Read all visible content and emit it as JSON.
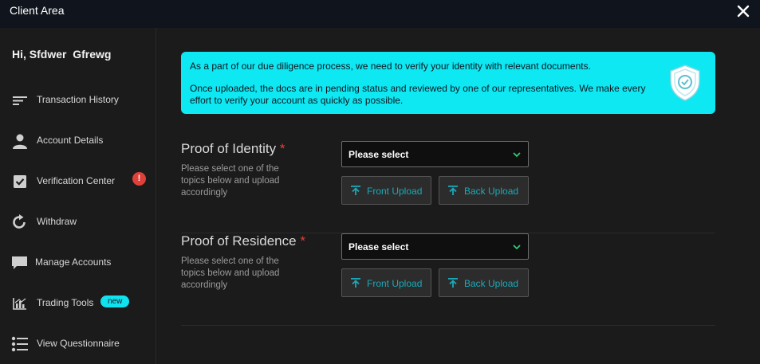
{
  "window": {
    "title": "Client Area"
  },
  "sidebar": {
    "greeting": "Hi, Sfdwer  Gfrewg",
    "items": [
      {
        "label": "Transaction History",
        "icon": "list-lines-icon"
      },
      {
        "label": "Account Details",
        "icon": "user-icon"
      },
      {
        "label": "Verification Center",
        "icon": "checkbox-icon",
        "badge": "!"
      },
      {
        "label": "Withdraw",
        "icon": "refresh-arrow-icon"
      },
      {
        "label": "Manage Accounts",
        "icon": "chat-bubble-icon"
      },
      {
        "label": "Trading Tools",
        "icon": "bar-chart-icon",
        "badge": "new"
      },
      {
        "label": "View Questionnaire",
        "icon": "bullet-list-icon"
      }
    ]
  },
  "main": {
    "info": {
      "line1": "As a part of our due diligence process, we need to verify your identity with relevant documents.",
      "line2": "Once uploaded, the docs are in pending status and reviewed by one of our representatives. We make every effort to verify your account as quickly as possible."
    },
    "sections": [
      {
        "title": "Proof of Identity",
        "required_mark": "*",
        "description": "Please select one of the topics below and upload accordingly",
        "select_value": "Please select",
        "front_label": "Front Upload",
        "back_label": "Back Upload"
      },
      {
        "title": "Proof of Residence",
        "required_mark": "*",
        "description": "Please select one of the topics below and upload accordingly",
        "select_value": "Please select",
        "front_label": "Front Upload",
        "back_label": "Back Upload"
      }
    ]
  },
  "colors": {
    "accent": "#0de8f3",
    "required": "#e0403a",
    "upload_text": "#1ba9b8",
    "chevron": "#2ecc71"
  }
}
